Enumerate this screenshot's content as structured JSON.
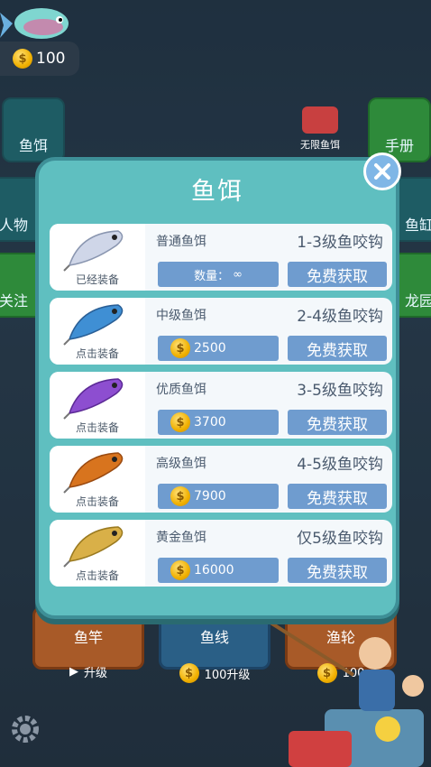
{
  "hud": {
    "coins": "100"
  },
  "side_left": [
    {
      "label": "鱼饵"
    },
    {
      "label": "人物"
    },
    {
      "label": "关注"
    }
  ],
  "side_right": [
    {
      "label": "手册"
    },
    {
      "label": "鱼缸"
    },
    {
      "label": "龙园"
    }
  ],
  "top_banner": {
    "label": "无限鱼饵"
  },
  "bottom_cards": [
    {
      "title": "鱼竿",
      "sub": "升级"
    },
    {
      "title": "鱼线",
      "sub": "100升级"
    },
    {
      "title": "渔轮",
      "sub": "100"
    }
  ],
  "modal": {
    "title": "鱼饵",
    "rows": [
      {
        "name": "普通鱼饵",
        "level": "1-3级鱼咬钩",
        "equip": "已经装备",
        "price_label": "数量：",
        "price_value": "∞",
        "free": "免费获取",
        "color": "#cfd6e8"
      },
      {
        "name": "中级鱼饵",
        "level": "2-4级鱼咬钩",
        "equip": "点击装备",
        "price_value": "2500",
        "free": "免费获取",
        "color": "#3f8fd4"
      },
      {
        "name": "优质鱼饵",
        "level": "3-5级鱼咬钩",
        "equip": "点击装备",
        "price_value": "3700",
        "free": "免费获取",
        "color": "#8d4ed0"
      },
      {
        "name": "高级鱼饵",
        "level": "4-5级鱼咬钩",
        "equip": "点击装备",
        "price_value": "7900",
        "free": "免费获取",
        "color": "#d8741e"
      },
      {
        "name": "黄金鱼饵",
        "level": "仅5级鱼咬钩",
        "equip": "点击装备",
        "price_value": "16000",
        "free": "免费获取",
        "color": "#d9b048"
      }
    ]
  }
}
